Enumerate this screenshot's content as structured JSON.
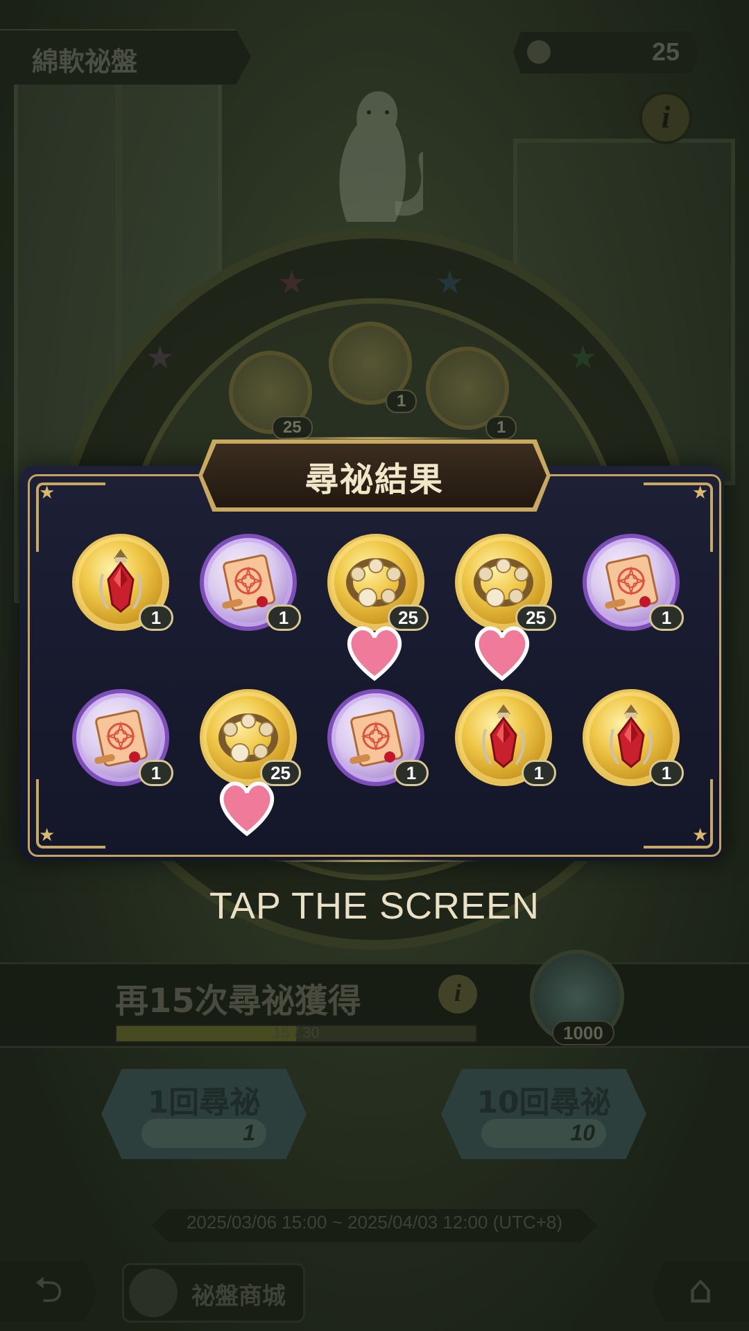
{
  "header": {
    "title": "綿軟祕盤",
    "currency_icon": "ticket-icon",
    "currency_value": "25",
    "info_label": "i"
  },
  "result": {
    "title": "尋祕結果",
    "items": [
      {
        "kind": "lantern",
        "frame": "gold",
        "count": "1",
        "heart": false
      },
      {
        "kind": "scroll",
        "frame": "purple",
        "count": "1",
        "heart": false
      },
      {
        "kind": "wreath",
        "frame": "gold",
        "count": "25",
        "heart": true
      },
      {
        "kind": "wreath",
        "frame": "gold",
        "count": "25",
        "heart": true
      },
      {
        "kind": "scroll",
        "frame": "purple",
        "count": "1",
        "heart": false
      },
      {
        "kind": "scroll",
        "frame": "purple",
        "count": "1",
        "heart": false
      },
      {
        "kind": "wreath",
        "frame": "gold",
        "count": "25",
        "heart": true
      },
      {
        "kind": "scroll",
        "frame": "purple",
        "count": "1",
        "heart": false
      },
      {
        "kind": "lantern",
        "frame": "gold",
        "count": "1",
        "heart": false
      },
      {
        "kind": "lantern",
        "frame": "gold",
        "count": "1",
        "heart": false
      }
    ]
  },
  "prompt": "TAP THE SCREEN",
  "milestone": {
    "text": "再15次尋祕獲得",
    "info_label": "i",
    "progress": "15 / 30",
    "progress_fraction": 0.5,
    "reward_count": "1000",
    "reward_icon": "diamond-gem-icon"
  },
  "draw": {
    "single_label": "1回尋祕",
    "single_cost": "1",
    "ten_label": "10回尋祕",
    "ten_cost": "10"
  },
  "event_period": "2025/03/06 15:00 ~ 2025/04/03 12:00 (UTC+8)",
  "footer": {
    "back_icon": "back-arrow-icon",
    "shop_label": "祕盤商城",
    "home_icon": "home-icon"
  },
  "colors": {
    "gold_frame": "#e8c45a",
    "purple_frame": "#7e4fb8",
    "modal_border": "#c2a45e",
    "modal_bg": "#1d2036"
  }
}
